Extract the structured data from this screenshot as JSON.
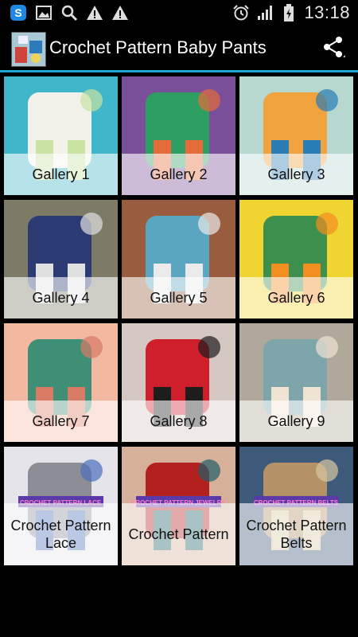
{
  "status_bar": {
    "time": "13:18",
    "left_icons": [
      "sync-s-icon",
      "image-icon",
      "search-icon",
      "warning-icon",
      "warning-icon"
    ],
    "right_icons": [
      "alarm-icon",
      "signal-icon",
      "battery-charging-icon"
    ]
  },
  "app_bar": {
    "title": "Crochet Pattern Baby Pants",
    "share_icon": "share-icon"
  },
  "accent_color": "#22a8d6",
  "tiles": [
    {
      "label": "Gallery 1",
      "colors": [
        "#3fb6c9",
        "#f1f1ea",
        "#c9e3a3"
      ]
    },
    {
      "label": "Gallery 2",
      "colors": [
        "#7a4f9a",
        "#2f9e63",
        "#e56b3a"
      ]
    },
    {
      "label": "Gallery 3",
      "colors": [
        "#b6d8cf",
        "#f0a23f",
        "#2a7db4"
      ]
    },
    {
      "label": "Gallery 4",
      "colors": [
        "#7d7a66",
        "#2c3b74",
        "#e0e0e0"
      ]
    },
    {
      "label": "Gallery 5",
      "colors": [
        "#9a5c3e",
        "#5aa5c0",
        "#eaeaea"
      ]
    },
    {
      "label": "Gallery 6",
      "colors": [
        "#f0d532",
        "#3c8f4c",
        "#f28d20"
      ]
    },
    {
      "label": "Gallery 7",
      "colors": [
        "#f2b9a0",
        "#3f8f76",
        "#d97b65"
      ]
    },
    {
      "label": "Gallery 8",
      "colors": [
        "#d5c7c2",
        "#cf1f2a",
        "#1d1d1d"
      ]
    },
    {
      "label": "Gallery 9",
      "colors": [
        "#b0a89a",
        "#7ea6aa",
        "#efe3d3"
      ]
    },
    {
      "label": "Crochet Pattern Lace",
      "overlay": "CROCHET PATTERN LACE",
      "colors": [
        "#e4e4ea",
        "#8d8e95",
        "#4b6fbe"
      ]
    },
    {
      "label": "Crochet Pattern",
      "overlay": "CROCHET PATTERN JEWELRY",
      "colors": [
        "#d7b09a",
        "#b32020",
        "#1f5f66"
      ]
    },
    {
      "label": "Crochet Pattern Belts",
      "overlay": "CROCHET PATTERN BELTS",
      "colors": [
        "#3e5a7a",
        "#b49167",
        "#d8c7a2"
      ]
    }
  ]
}
